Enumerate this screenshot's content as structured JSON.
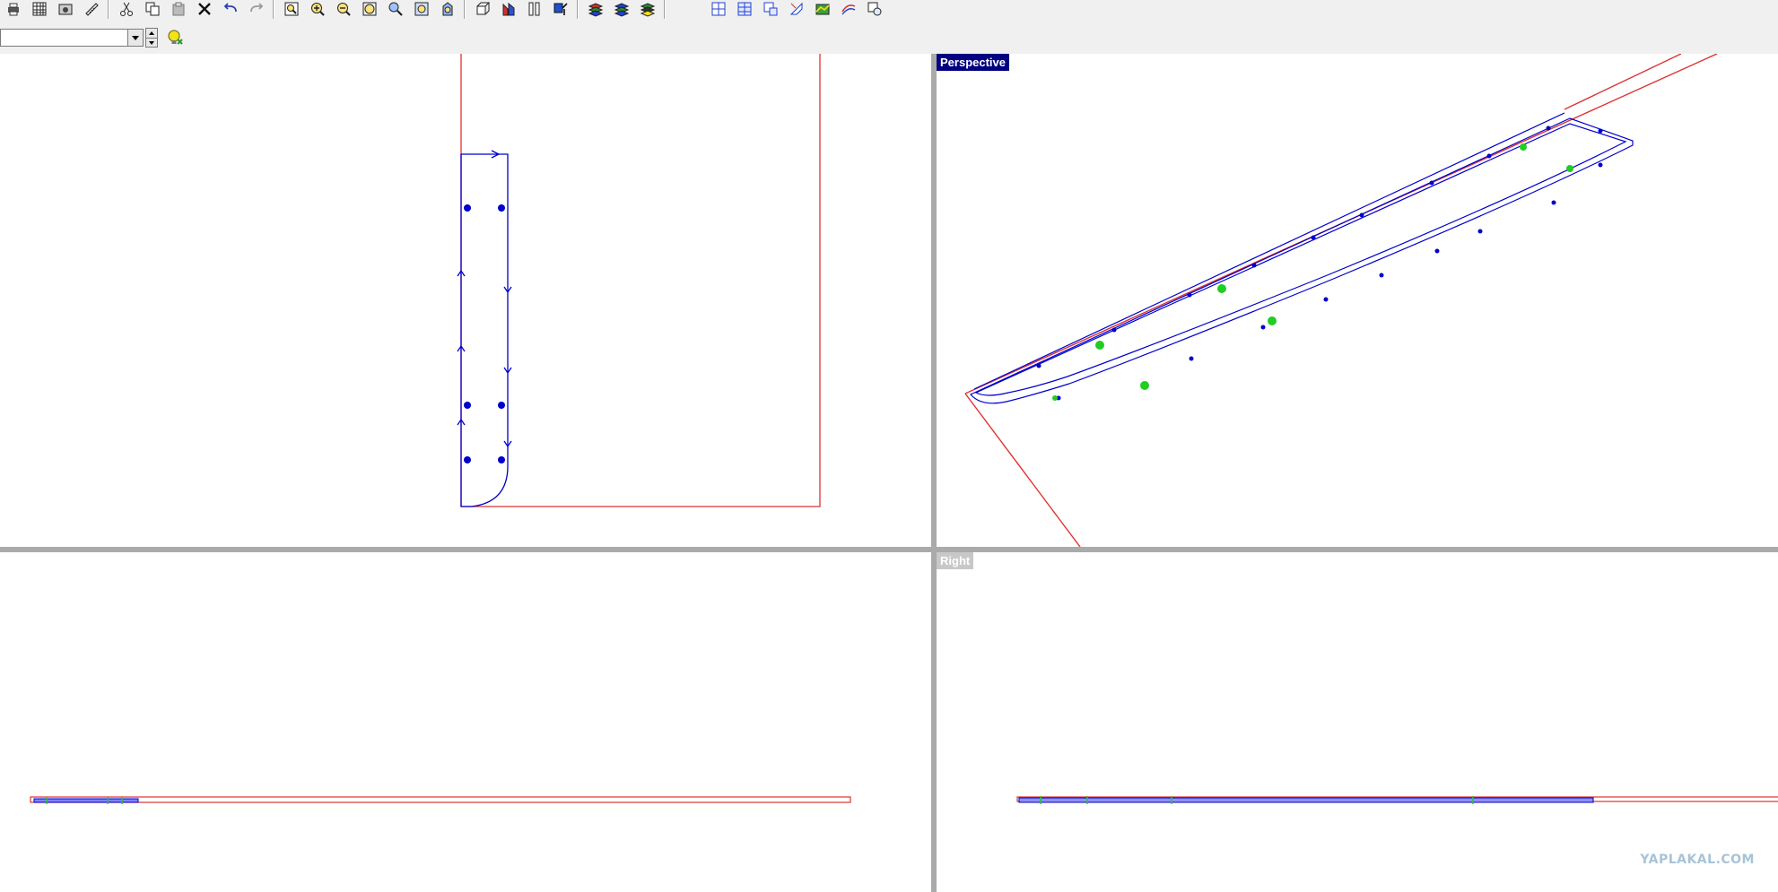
{
  "toolbar": {
    "row1_groups": [
      [
        "print-icon",
        "grid-icon",
        "capture-icon",
        "measure-icon"
      ],
      [
        "cut-icon",
        "copy-icon",
        "paste-icon",
        "delete-icon",
        "undo-icon",
        "redo-icon"
      ],
      [
        "zoom-window-icon",
        "zoom-in-icon",
        "zoom-out-icon",
        "zoom-extents-icon",
        "zoom-selected-icon",
        "zoom-target-icon",
        "zoom-dynamic-icon"
      ],
      [
        "box-icon",
        "shade-icon",
        "render-icon",
        "properties-icon"
      ],
      [
        "layer-red-icon",
        "layer-blue-icon",
        "layer-yellow-icon"
      ],
      [
        "viewport-layout-icon",
        "viewport-four-icon",
        "viewport-three-icon",
        "named-view-icon",
        "terrain-icon",
        "curve-icon",
        "view-options-icon"
      ]
    ],
    "combo_value": "",
    "bulb_icon": "lightbulb-icon"
  },
  "viewports": {
    "top": {
      "label": ""
    },
    "perspective": {
      "label": "Perspective"
    },
    "front": {
      "label": ""
    },
    "right": {
      "label": "Right"
    }
  },
  "colors": {
    "curve": "#0000cc",
    "boundary": "#dd3333",
    "points": "#22cc22",
    "active_label_bg": "#000080"
  },
  "watermark": "YAPLAKAL.COM"
}
